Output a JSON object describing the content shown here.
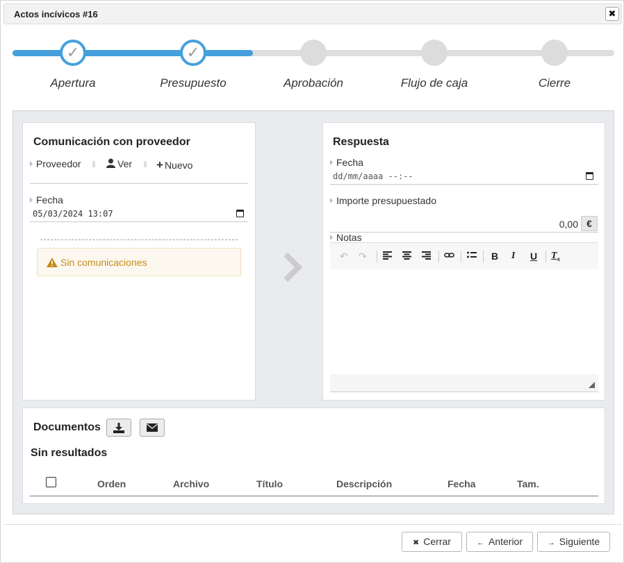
{
  "dialog": {
    "title": "Actos incívicos #16",
    "close_label": "✖"
  },
  "stepper": {
    "steps": [
      {
        "label": "Apertura",
        "state": "done"
      },
      {
        "label": "Presupuesto",
        "state": "done"
      },
      {
        "label": "Aprobación",
        "state": "pending"
      },
      {
        "label": "Flujo de caja",
        "state": "pending"
      },
      {
        "label": "Cierre",
        "state": "pending"
      }
    ]
  },
  "comunicacion": {
    "title": "Comunicación con proveedor",
    "proveedor_label": "Proveedor",
    "ver_label": "Ver",
    "nuevo_label": "Nuevo",
    "fecha_label": "Fecha",
    "fecha_value": "05/03/2024 13:07",
    "empty_message": "Sin comunicaciones"
  },
  "respuesta": {
    "title": "Respuesta",
    "fecha_label": "Fecha",
    "fecha_placeholder": "dd/mm/aaaa --:--",
    "importe_label": "Importe presupuestado",
    "importe_value": "0,00",
    "currency": "€",
    "notas_label": "Notas"
  },
  "documentos": {
    "title": "Documentos",
    "empty_message": "Sin resultados",
    "columns": [
      "Orden",
      "Archivo",
      "Título",
      "Descripción",
      "Fecha",
      "Tam."
    ]
  },
  "footer": {
    "cerrar_label": "Cerrar",
    "anterior_label": "Anterior",
    "siguiente_label": "Siguiente"
  },
  "colors": {
    "accent": "#45a0dc",
    "warning_text": "#c58a1b",
    "warning_bg": "#fcf8ef"
  }
}
